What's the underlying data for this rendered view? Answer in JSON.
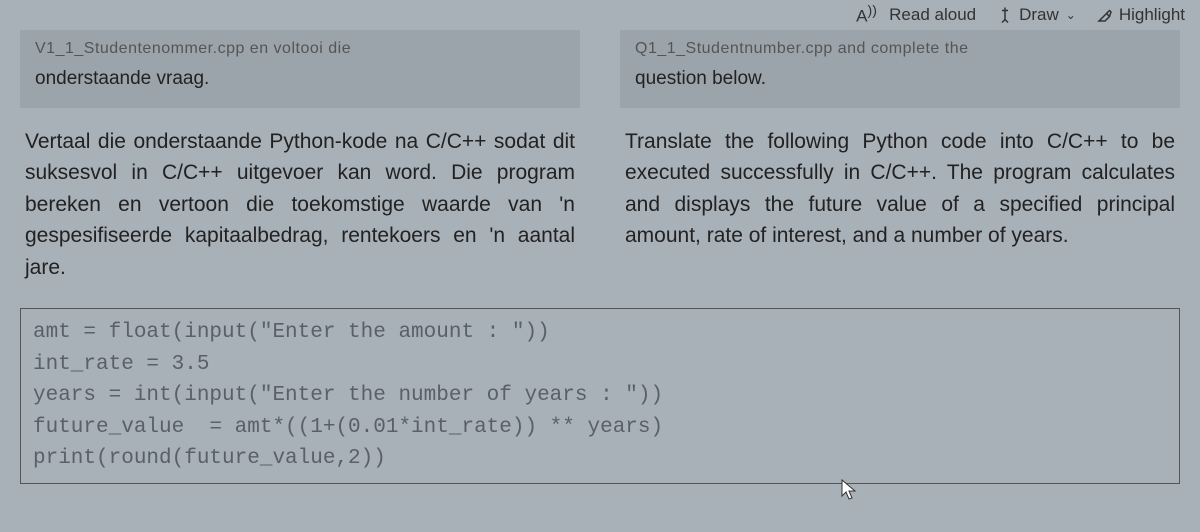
{
  "toolbar": {
    "read_aloud": "Read aloud",
    "draw": "Draw",
    "highlight": "Highlight"
  },
  "left": {
    "file_line": "V1_1_Studentenommer.cpp   en   voltooi   die",
    "intro": "onderstaande vraag.",
    "question": "Vertaal die onderstaande Python-kode na C/C++ sodat dit suksesvol in C/C++ uitgevoer kan word. Die program bereken en vertoon die toekomstige waarde van 'n gespesifiseerde kapitaalbedrag, rentekoers en 'n aantal jare."
  },
  "right": {
    "file_line": "Q1_1_Studentnumber.cpp   and   complete   the",
    "intro": "question below.",
    "question": "Translate the following Python code into C/C++ to be executed successfully in C/C++. The program calculates and displays the future value of a specified principal amount, rate of interest, and a number of years."
  },
  "code": "amt = float(input(\"Enter the amount : \"))\nint_rate = 3.5\nyears = int(input(\"Enter the number of years : \"))\nfuture_value  = amt*((1+(0.01*int_rate)) ** years)\nprint(round(future_value,2))"
}
